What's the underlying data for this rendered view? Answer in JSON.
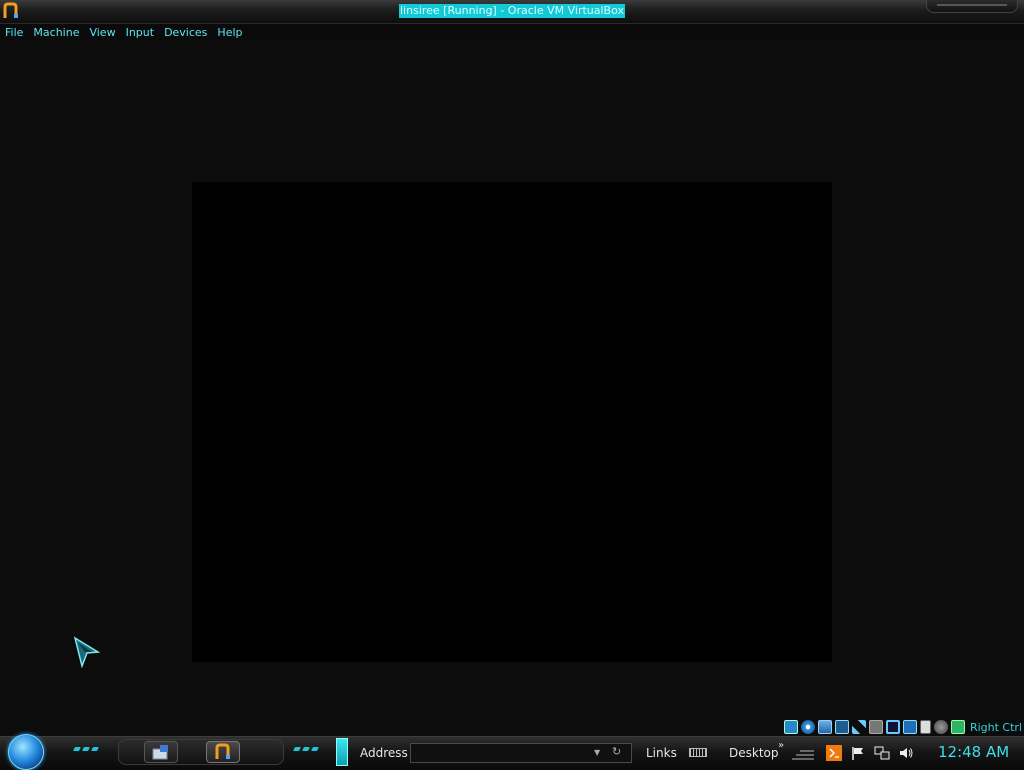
{
  "window": {
    "title": "linsiree [Running] - Oracle VM VirtualBox",
    "app_icon": "virtualbox-icon"
  },
  "menubar": {
    "items": [
      {
        "label": "File"
      },
      {
        "label": "Machine"
      },
      {
        "label": "View"
      },
      {
        "label": "Input"
      },
      {
        "label": "Devices"
      },
      {
        "label": "Help"
      }
    ]
  },
  "vm_status": {
    "icons": [
      "hard-disk-icon",
      "optical-drive-icon",
      "floppy-icon",
      "network-icon",
      "usb-icon",
      "shared-folders-icon",
      "display-icon",
      "recording-icon",
      "virtualization-icon",
      "mouse-integration-icon",
      "keyboard-capture-icon"
    ],
    "host_key": "Right Ctrl"
  },
  "taskbar": {
    "address_label": "Address",
    "address_value": "",
    "links_label": "Links",
    "desktop_label": "Desktop",
    "chevron": "»",
    "clock": "12:48 AM",
    "tasks": [
      "explorer-task",
      "virtualbox-task"
    ],
    "tray_icons": [
      "java-icon",
      "action-center-flag-icon",
      "network-tray-icon",
      "volume-icon"
    ]
  },
  "colors": {
    "accent": "#12c9d8",
    "menu_text": "#5ee6ee",
    "background": "#0c0c0c",
    "vm_screen": "#000000"
  }
}
